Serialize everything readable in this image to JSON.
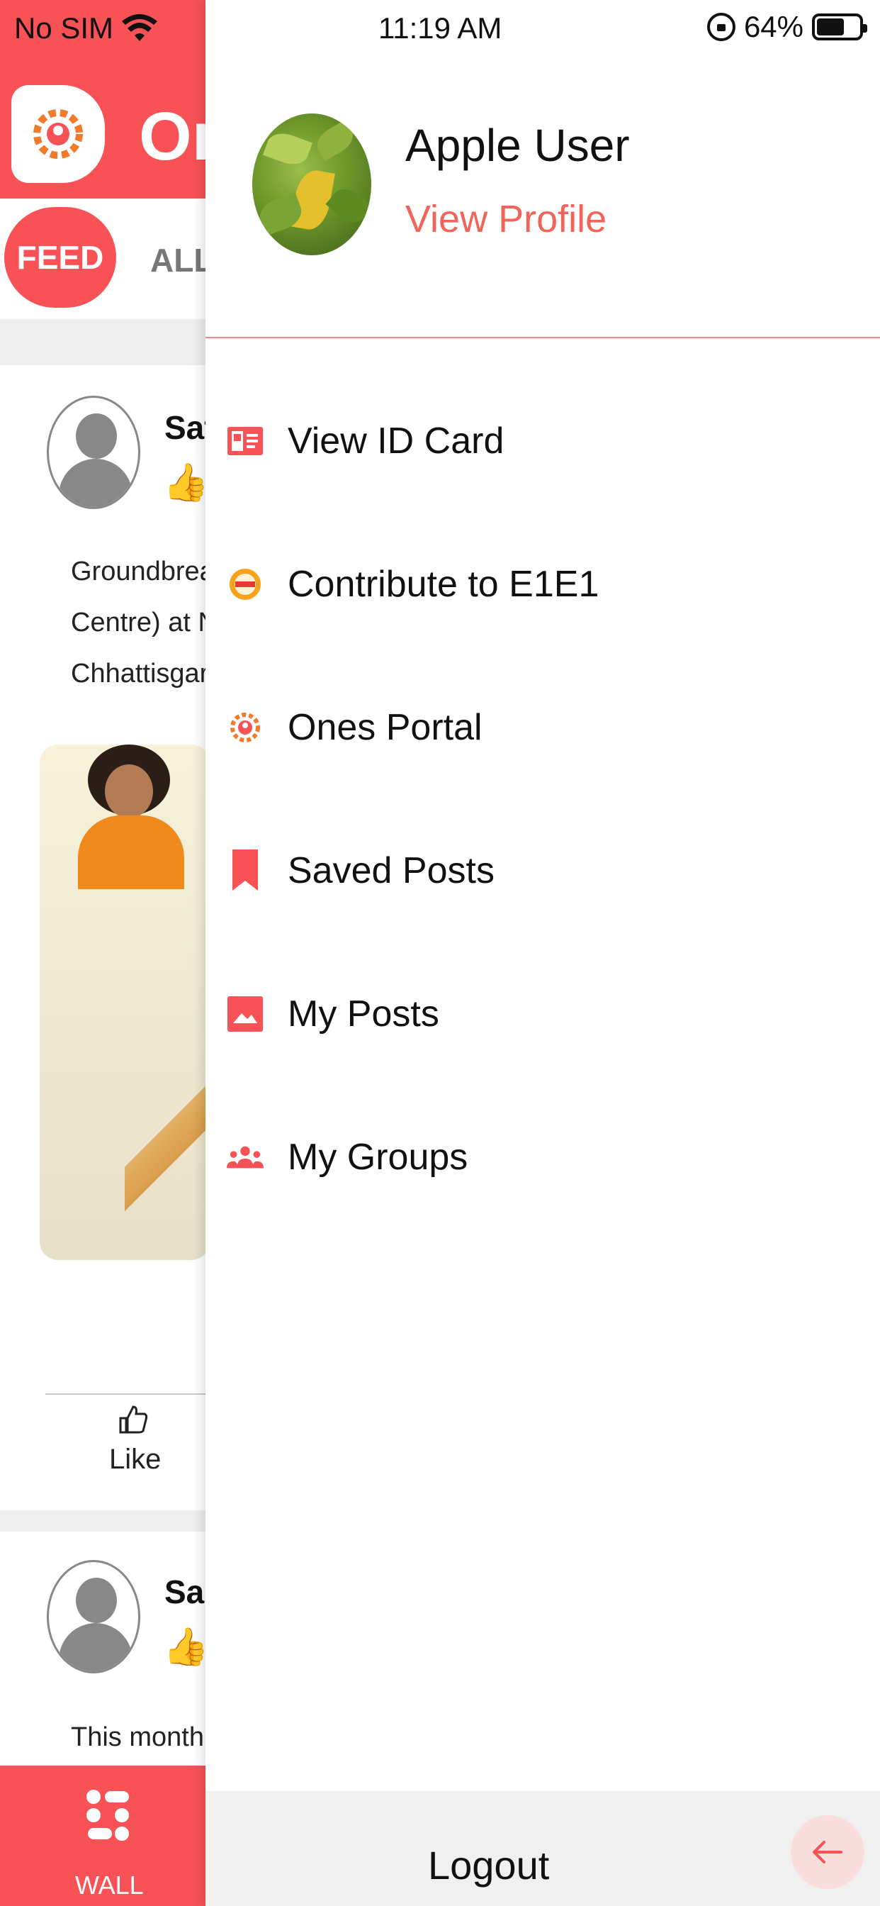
{
  "status_bar": {
    "carrier": "No SIM",
    "time": "11:19 AM",
    "battery": "64%"
  },
  "background_app": {
    "title_partial": "On",
    "tabs": [
      "FEED",
      "ALL"
    ],
    "posts": [
      {
        "author_partial": "Sat",
        "text_lines": [
          "Groundbrea",
          "Centre) at N",
          "Chhattisgar"
        ]
      },
      {
        "author_partial": "Sa",
        "text_lines": [
          "This month,"
        ]
      }
    ],
    "like_label": "Like",
    "bottom_nav_label": "WALL"
  },
  "drawer": {
    "profile": {
      "name": "Apple User",
      "link": "View Profile"
    },
    "menu": [
      {
        "label": "View ID Card",
        "icon": "id-card-icon"
      },
      {
        "label": "Contribute to E1E1",
        "icon": "contribute-badge-icon"
      },
      {
        "label": "Ones Portal",
        "icon": "portal-gear-icon"
      },
      {
        "label": "Saved Posts",
        "icon": "bookmark-icon"
      },
      {
        "label": "My Posts",
        "icon": "image-icon"
      },
      {
        "label": "My Groups",
        "icon": "group-icon"
      }
    ],
    "logout": "Logout"
  },
  "colors": {
    "brand": "#f85256",
    "link": "#f0645a"
  }
}
